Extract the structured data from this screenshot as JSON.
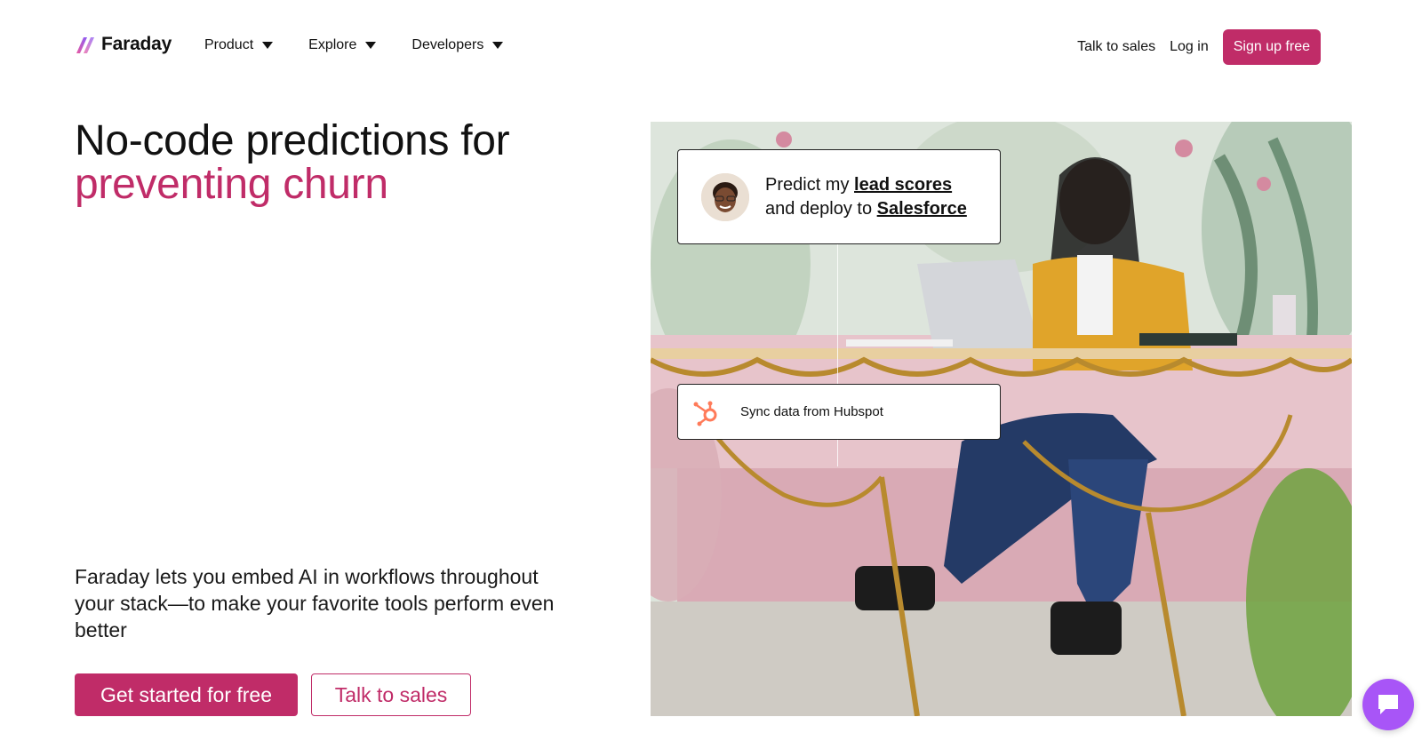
{
  "brand": {
    "name": "Faraday",
    "accent": "#c02c68",
    "logo_gradient": [
      "#e85aa1",
      "#8b5cf6"
    ]
  },
  "nav": {
    "menu": [
      {
        "label": "Product"
      },
      {
        "label": "Explore"
      },
      {
        "label": "Developers"
      }
    ],
    "talk_to_sales": "Talk to sales",
    "log_in": "Log in",
    "sign_up": "Sign up free"
  },
  "hero": {
    "headline_line1": "No-code predictions for",
    "headline_line2": "preventing churn",
    "lede": "Faraday lets you embed AI in workflows throughout your stack—to make your favorite tools perform even better",
    "cta_primary": "Get started for free",
    "cta_secondary": "Talk to sales"
  },
  "photo_cards": {
    "predict_prefix": "Predict my ",
    "predict_link1": "lead scores",
    "predict_middle": "and deploy to ",
    "predict_link2": "Salesforce",
    "sync_text": "Sync data from Hubspot"
  },
  "chat": {
    "icon": "chat-bubble-icon",
    "color": "#a855f7"
  }
}
